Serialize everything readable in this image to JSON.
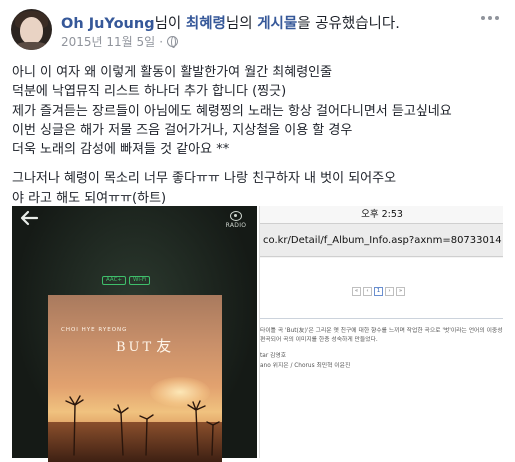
{
  "header": {
    "author": "Oh JuYoung",
    "particle1": "님이 ",
    "shared_from": "최혜령",
    "particle2": "님의 ",
    "shared_item": "게시물",
    "suffix": "을 공유했습니다.",
    "date": "2015년 11월 5일",
    "separator": "·"
  },
  "post": {
    "lines": [
      "아니 이 여자 왜 이렇게 활동이 활발한가여 월간 최혜령인줄",
      "덕분에 낙엽뮤직 리스트 하나더 추가 합니다 (찡긋)",
      "제가 즐겨듣는 장르들이 아님에도 혜령찡의 노래는 항상 걸어다니면서 듣고싶네요",
      "이번 싱글은 해가 저물 즈음 걸어가거나, 지상철을 이용 할 경우",
      "더욱 노래의 감성에 빠져들 것 같아요 **",
      "그나저나 혜령이 목소리 너무 좋다ㅠㅠ 나랑 친구하자 내 벗이 되어주오",
      "야 라고 해도 되여ㅠㅠ(하트)"
    ]
  },
  "image_left": {
    "radio_label": "RADIO",
    "badges": [
      "AAC+",
      "Wi-Fi"
    ],
    "album_artist": "CHOI HYE RYEONG",
    "album_title": "BUT",
    "album_title_hanja": "友"
  },
  "image_right": {
    "time": "오후 2:53",
    "url": "co.kr/Detail/f_Album_Info.asp?axnm=80733014",
    "pager": [
      "«",
      "‹",
      "1",
      "›",
      "»"
    ],
    "detail_line1": "타이틀 곡 'But(友)'은 그리운 옛 친구에 대한 향수를 느끼며 작업한 곡으로 '벗'이라는 언어의 이중성을 사용하여 가사",
    "detail_line2": "편곡되어 곡의 이미지를 한층 성숙하게 만들었다.",
    "credit1": "tar 김영호",
    "credit2": "ano 위지은 / Chorus 최민혁 이윤진"
  },
  "colors": {
    "link": "#365899",
    "meta": "#90949c",
    "text": "#1d2129",
    "badge": "#3fbf6b"
  }
}
